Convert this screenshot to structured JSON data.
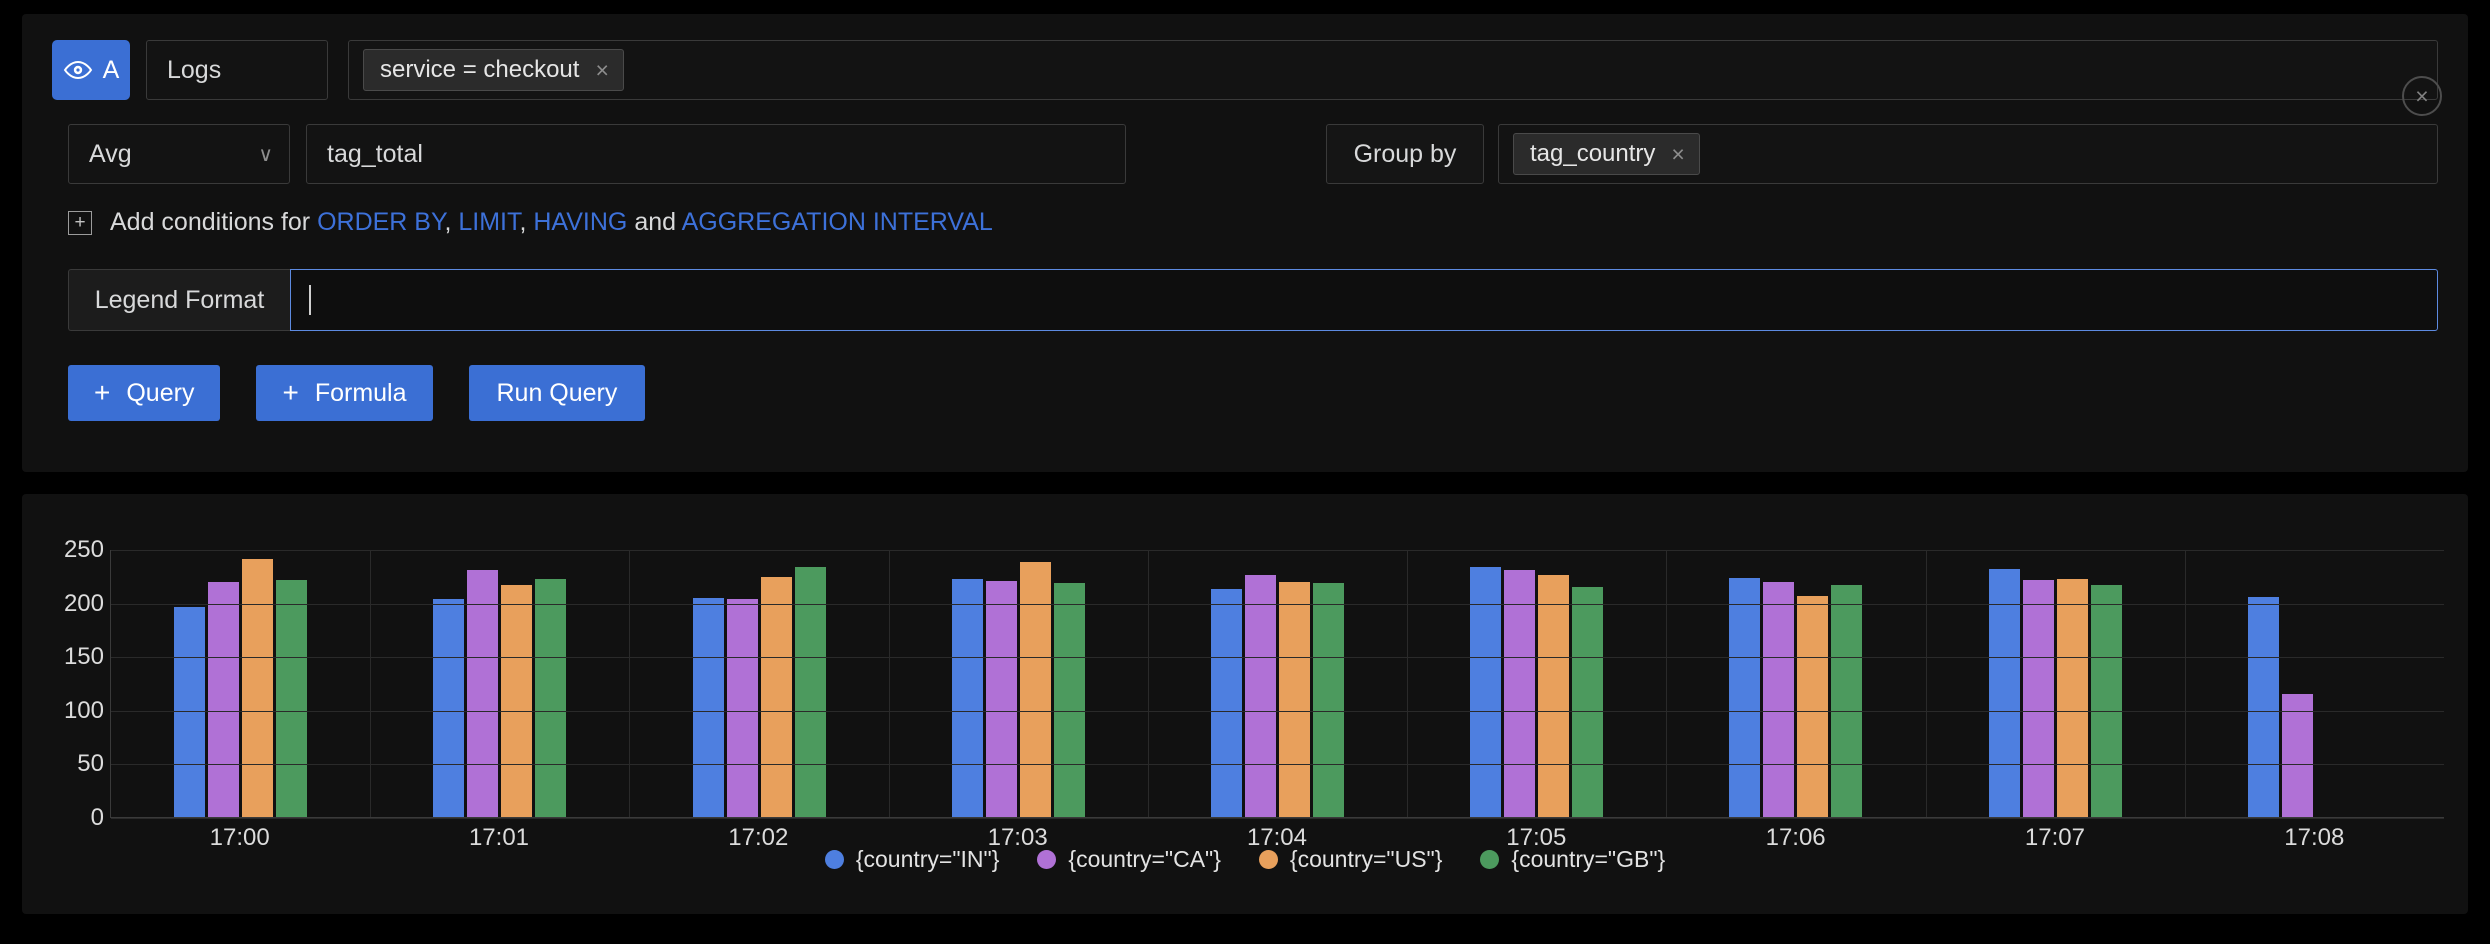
{
  "query_editor": {
    "ref_id": "A",
    "eye_icon": "eye-icon",
    "datasource": "Logs",
    "filters": [
      {
        "label": "service = checkout",
        "remove": "×"
      }
    ],
    "close_label": "×",
    "aggregation": {
      "value": "Avg",
      "chevron": "∨"
    },
    "metric": "tag_total",
    "group_by_label": "Group by",
    "group_by_chips": [
      {
        "label": "tag_country",
        "remove": "×"
      }
    ],
    "conditions": {
      "plus": "+",
      "prefix": "Add conditions for ",
      "links": [
        "ORDER BY",
        "LIMIT",
        "HAVING",
        "AGGREGATION INTERVAL"
      ],
      "sep1": ", ",
      "sep2": ", ",
      "sep3": " and "
    },
    "legend_format": {
      "label": "Legend Format",
      "value": "",
      "placeholder": ""
    },
    "buttons": {
      "add_query": "Query",
      "add_formula": "Formula",
      "plus": "+",
      "run_query": "Run Query"
    },
    "accent_color": "#3b6fd4"
  },
  "chart_data": {
    "type": "bar",
    "title": "",
    "xlabel": "",
    "ylabel": "",
    "ylim": [
      0,
      250
    ],
    "yticks": [
      0,
      50,
      100,
      150,
      200,
      250
    ],
    "grid": true,
    "legend_position": "bottom",
    "categories": [
      "17:00",
      "17:01",
      "17:02",
      "17:03",
      "17:04",
      "17:05",
      "17:06",
      "17:07",
      "17:08"
    ],
    "series": [
      {
        "name": "{country=\"IN\"}",
        "color": "#4e7fe0",
        "values": [
          196,
          203,
          204,
          222,
          213,
          233,
          223,
          231,
          205
        ]
      },
      {
        "name": "{country=\"CA\"}",
        "color": "#b071d6",
        "values": [
          219,
          230,
          203,
          220,
          226,
          230,
          219,
          221,
          115
        ]
      },
      {
        "name": "{country=\"US\"}",
        "color": "#e8a05c",
        "values": [
          241,
          216,
          224,
          238,
          219,
          226,
          206,
          222,
          null
        ]
      },
      {
        "name": "{country=\"GB\"}",
        "color": "#4c9a5e",
        "values": [
          221,
          222,
          233,
          218,
          218,
          215,
          216,
          216,
          null
        ]
      }
    ]
  }
}
